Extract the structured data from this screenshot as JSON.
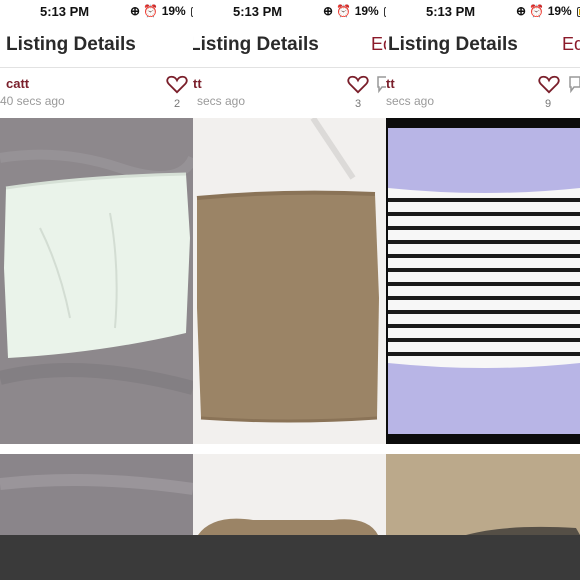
{
  "columns": [
    {
      "status": {
        "time": "5:13 PM",
        "battery": "19%"
      },
      "title": "Listing Details",
      "edit_label": "",
      "username": "catt",
      "time_ago": "40 secs ago",
      "like_count": "2",
      "photo_desc": "white strapless tube top on grey blanket"
    },
    {
      "status": {
        "time": "5:13 PM",
        "battery": "19%"
      },
      "title": "Listing Details",
      "edit_label": "Ed",
      "username": "tt",
      "time_ago": "secs ago",
      "like_count": "3",
      "photo_desc": "tan strapless tube top on white sheet"
    },
    {
      "status": {
        "time": "5:13 PM",
        "battery": "19%"
      },
      "title": "Listing Details",
      "edit_label": "Ed",
      "username": "tt",
      "time_ago": "secs ago",
      "like_count": "9",
      "photo_desc": "black and white striped tube top"
    }
  ],
  "colors": {
    "accent": "#7a1f2b",
    "bottom_bar": "#3a3a3a"
  }
}
